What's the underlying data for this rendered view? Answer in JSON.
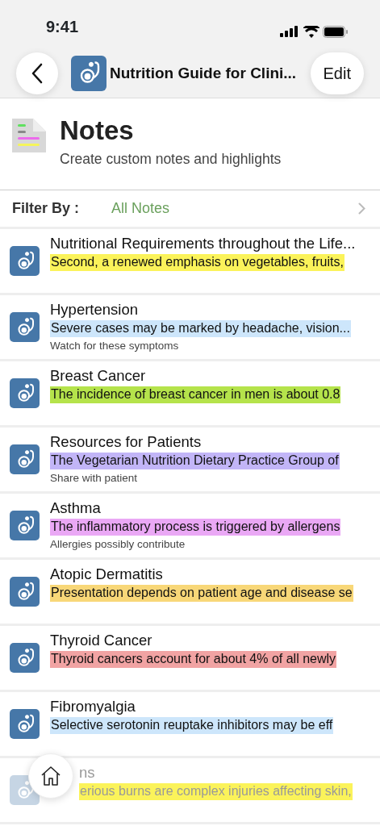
{
  "status_bar": {
    "time": "9:41"
  },
  "nav": {
    "title": "Nutrition Guide for Clini...",
    "edit_label": "Edit"
  },
  "header": {
    "title": "Notes",
    "subtitle": "Create custom notes and highlights"
  },
  "filter": {
    "label": "Filter By :",
    "value": "All Notes"
  },
  "notes": [
    {
      "title": "Nutritional Requirements throughout the Life...",
      "highlight": "Second, a renewed emphasis on vegetables, fruits,",
      "color": "#fbf35a",
      "faded": false
    },
    {
      "title": "Hypertension",
      "highlight": "Severe cases may be marked by headache, vision...",
      "color": "#cde6fb",
      "note": "Watch for these symptoms",
      "faded": false
    },
    {
      "title": "Breast Cancer",
      "highlight": "The incidence of breast cancer in men is about 0.8",
      "color": "#b5e34b",
      "faded": false
    },
    {
      "title": "Resources for Patients",
      "highlight": "The Vegetarian Nutrition Dietary Practice Group of",
      "color": "#c2b5f7",
      "note": "Share with patient",
      "faded": false
    },
    {
      "title": "Asthma",
      "highlight": "The inflammatory process is triggered by allergens",
      "color": "#eaa8f5",
      "note": "Allergies possibly contribute",
      "faded": false
    },
    {
      "title": "Atopic Dermatitis",
      "highlight": "Presentation depends on patient age and disease se",
      "color": "#f8d778",
      "faded": false
    },
    {
      "title": "Thyroid Cancer",
      "highlight": "Thyroid cancers account for about 4% of all newly",
      "color": "#f1a3a3",
      "faded": false
    },
    {
      "title": "Fibromyalgia",
      "highlight": "Selective serotonin reuptake inhibitors may be eff",
      "color": "#cde6fb",
      "faded": false
    },
    {
      "title": "ns",
      "highlight": "erious burns are complex injuries affecting skin,",
      "color": "#fbf35a",
      "faded": true
    }
  ]
}
